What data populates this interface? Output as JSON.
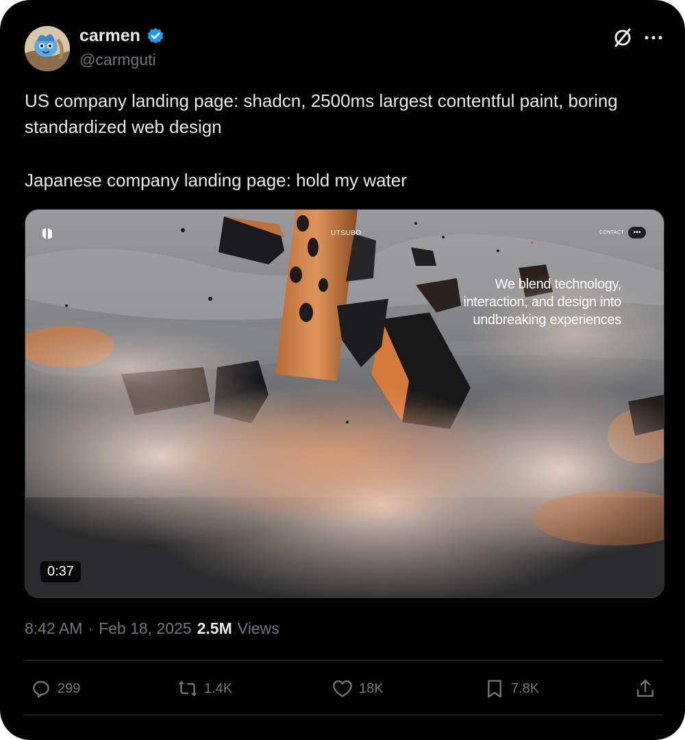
{
  "author": {
    "display_name": "carmen",
    "handle": "@carmguti",
    "verified": true,
    "avatar_icon": "cartoon-character-avatar"
  },
  "tweet": {
    "paragraph_1": "US company landing page: shadcn, 2500ms largest contentful paint, boring standardized web design",
    "paragraph_2": "Japanese company landing page: hold my water"
  },
  "media": {
    "type": "video",
    "duration": "0:37",
    "site": {
      "brand": "UTSUBO",
      "nav_link": "CONTACT",
      "menu_label": "•••",
      "hero_lines": [
        "We blend technology,",
        "interaction, and design into",
        "undbreaking experiences"
      ]
    }
  },
  "meta": {
    "time": "8:42 AM",
    "separator": "·",
    "date": "Feb 18, 2025",
    "views_count": "2.5M",
    "views_label": "Views"
  },
  "actions": {
    "replies": "299",
    "reposts": "1.4K",
    "likes": "18K",
    "bookmarks": "7.8K"
  },
  "colors": {
    "background": "#000000",
    "text_primary": "#e7e9ea",
    "text_secondary": "#71767b",
    "verified_blue": "#1d9bf0",
    "divider": "#2f3336"
  }
}
